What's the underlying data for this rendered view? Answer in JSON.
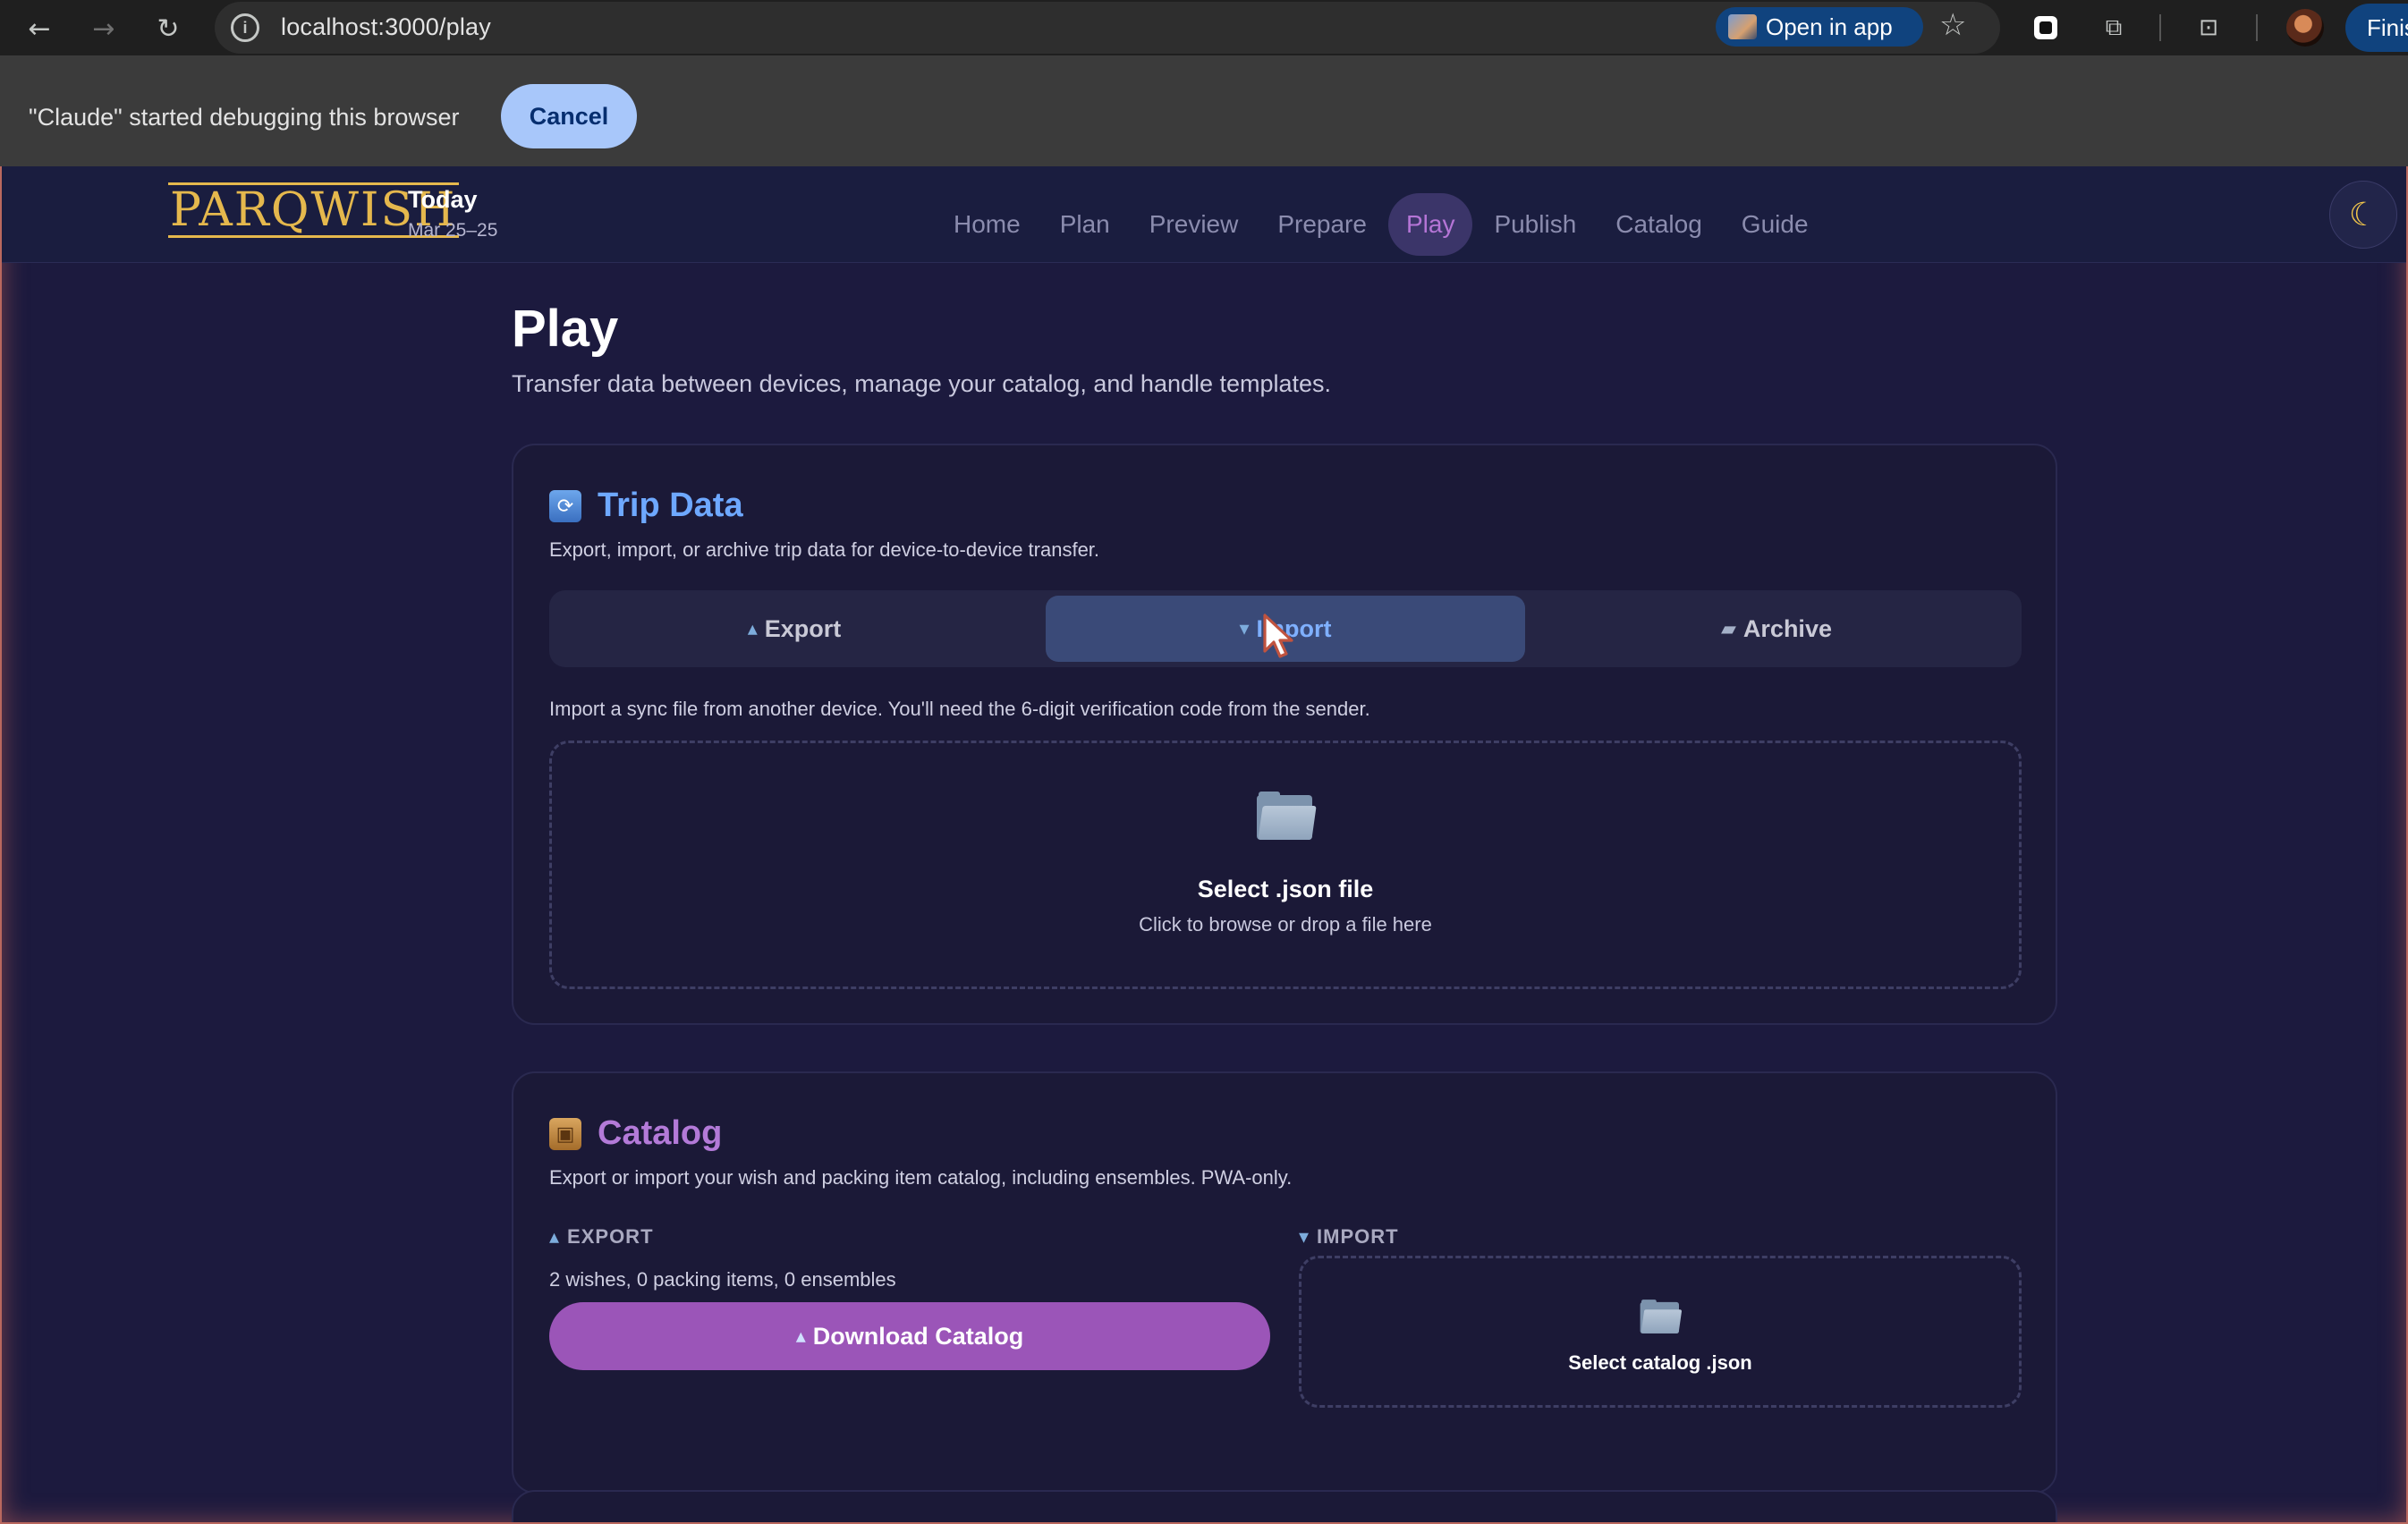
{
  "browser": {
    "url": "localhost:3000/play",
    "open_in_app": "Open in app",
    "finish_label": "Finis",
    "debug_message": "\"Claude\" started debugging this browser",
    "cancel_label": "Cancel"
  },
  "app": {
    "logo": "PARQWISH",
    "today_label": "Today",
    "date_range": "Mar 25–25",
    "nav": [
      "Home",
      "Plan",
      "Preview",
      "Prepare",
      "Play",
      "Publish",
      "Catalog",
      "Guide"
    ],
    "active_nav": "Play",
    "theme_icon": "moon-icon"
  },
  "page": {
    "title": "Play",
    "subtitle": "Transfer data between devices, manage your catalog, and handle templates."
  },
  "trip_data": {
    "icon": "sync-icon",
    "title": "Trip Data",
    "description": "Export, import, or archive trip data for device-to-device transfer.",
    "tabs": [
      {
        "label": "Export",
        "icon": "outbox-icon"
      },
      {
        "label": "Import",
        "icon": "inbox-icon"
      },
      {
        "label": "Archive",
        "icon": "folder-icon"
      }
    ],
    "active_tab": "Import",
    "import_note": "Import a sync file from another device. You'll need the 6-digit verification code from the sender.",
    "dropzone_title": "Select .json file",
    "dropzone_sub": "Click to browse or drop a file here"
  },
  "catalog": {
    "icon": "package-icon",
    "title": "Catalog",
    "description": "Export or import your wish and packing item catalog, including ensembles. PWA-only.",
    "export_label": "EXPORT",
    "import_label": "IMPORT",
    "stats": "2 wishes, 0 packing items, 0 ensembles",
    "download_label": "Download Catalog",
    "select_label": "Select catalog .json"
  },
  "colors": {
    "background": "#1c1a3e",
    "accent_purple": "#9b55b8",
    "accent_blue": "#6ea8ff",
    "logo_gold": "#e5b84d"
  }
}
